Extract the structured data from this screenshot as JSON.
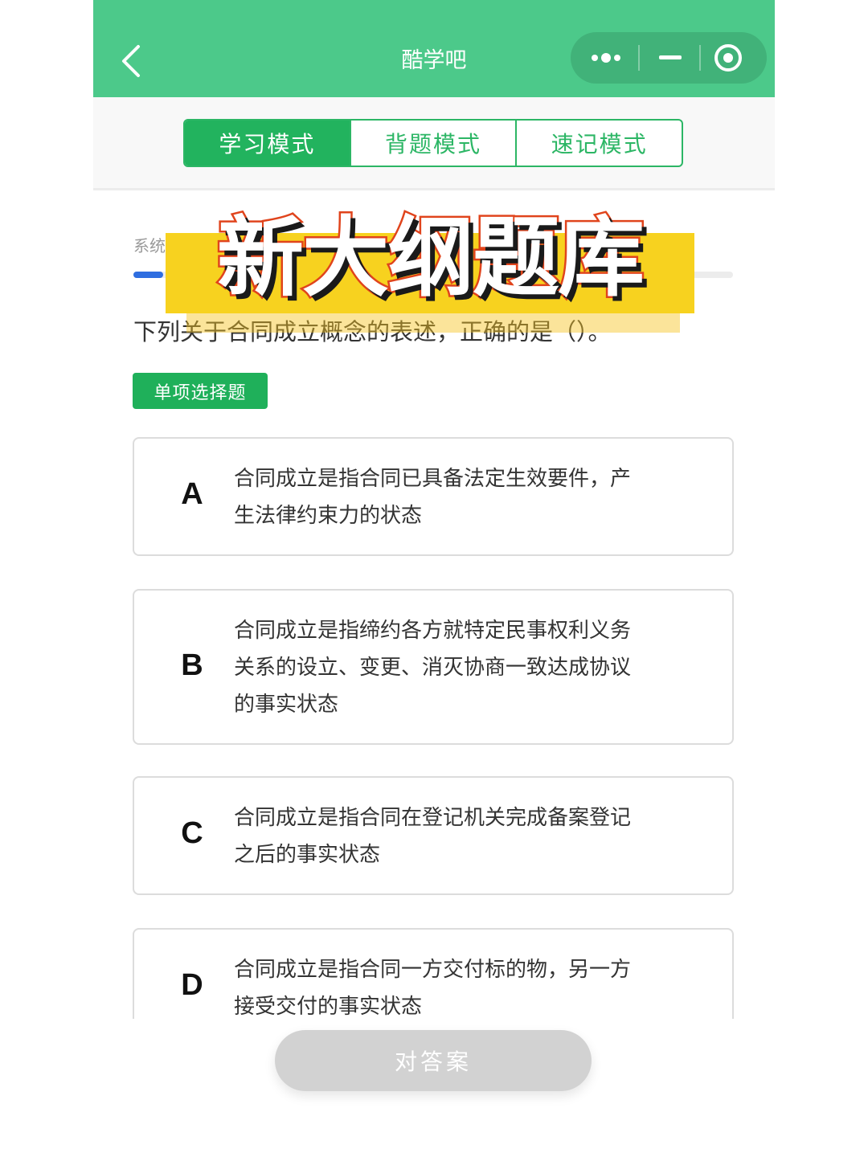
{
  "header": {
    "title": "酷学吧",
    "colors": {
      "background": "#4cc98a"
    },
    "icons": [
      "chevron-left-icon",
      "more-dots-icon",
      "minimize-icon",
      "close-circle-icon"
    ]
  },
  "tabs": [
    {
      "label": "学习模式",
      "active": true
    },
    {
      "label": "背题模式",
      "active": false
    },
    {
      "label": "速记模式",
      "active": false
    }
  ],
  "progress": {
    "label": "系统",
    "fraction": 0.05
  },
  "question": {
    "text": "下列关于合同成立概念的表述，正确的是（）。",
    "type_label": "单项选择题"
  },
  "options": [
    {
      "letter": "A",
      "lines": [
        "合同成立是指合同已具备法定生效要件，产",
        "生法律约束力的状态"
      ]
    },
    {
      "letter": "B",
      "lines": [
        "合同成立是指缔约各方就特定民事权利义务",
        "关系的设立、变更、消灭协商一致达成协议",
        "的事实状态"
      ]
    },
    {
      "letter": "C",
      "lines": [
        "合同成立是指合同在登记机关完成备案登记",
        "之后的事实状态"
      ]
    },
    {
      "letter": "D",
      "lines": [
        "合同成立是指合同一方交付标的物，另一方",
        "接受交付的事实状态"
      ]
    }
  ],
  "answer_button": {
    "label": "对答案"
  },
  "overlay": {
    "text": "新大纲题库"
  },
  "colors": {
    "primary_green": "#22b35e",
    "progress_blue": "#2f6ee0",
    "banner_yellow": "#f7d21f",
    "banner_stroke": "#e0441c"
  }
}
